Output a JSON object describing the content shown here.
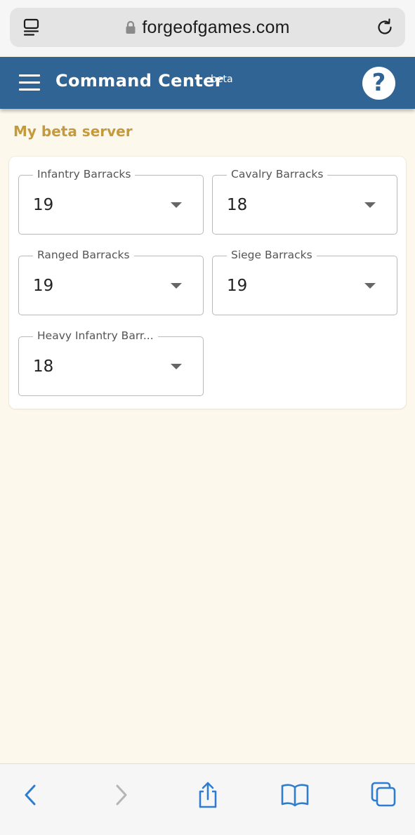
{
  "browser": {
    "url": "forgeofgames.com",
    "icons": {
      "reader": "reader-mode-icon",
      "lock": "lock-icon",
      "reload": "reload-icon"
    }
  },
  "header": {
    "title": "Command Center",
    "badge": "beta",
    "menu_icon": "hamburger-menu-icon",
    "help_icon": "help-icon",
    "help_glyph": "?",
    "background_color": "#2f6494"
  },
  "page": {
    "title": "My beta server",
    "title_color": "#c49a3c",
    "background_color": "#fdf8ec"
  },
  "fields": [
    {
      "label": "Infantry Barracks",
      "value": "19"
    },
    {
      "label": "Cavalry Barracks",
      "value": "18"
    },
    {
      "label": "Ranged Barracks",
      "value": "19"
    },
    {
      "label": "Siege Barracks",
      "value": "19"
    },
    {
      "label": "Heavy Infantry Barr...",
      "value": "18"
    }
  ],
  "toolbar": {
    "icons": [
      "back-icon",
      "forward-icon",
      "share-icon",
      "bookmarks-icon",
      "tabs-icon"
    ],
    "accent_color": "#2f7dd1",
    "disabled_color": "#b5b5b5"
  }
}
